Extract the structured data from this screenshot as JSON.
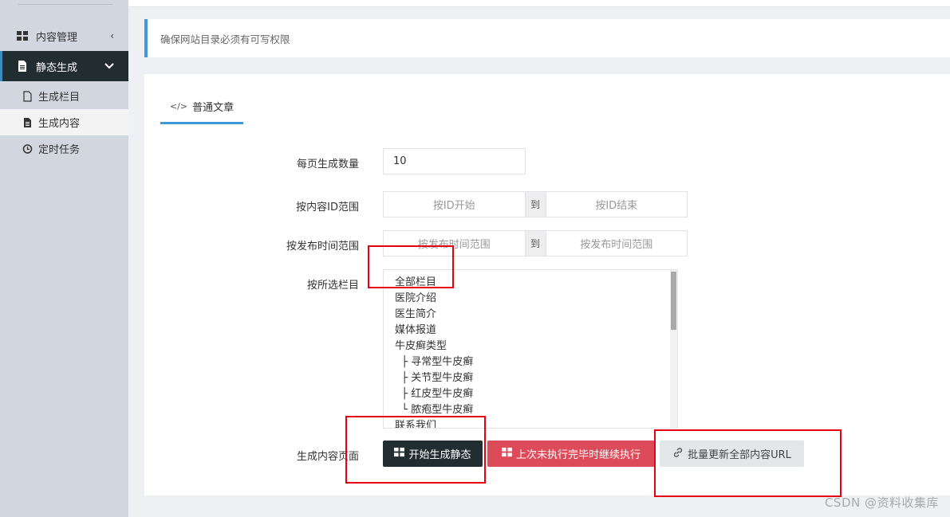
{
  "sidebar": {
    "content_manage": {
      "label": "内容管理",
      "arrow": "‹"
    },
    "static_gen": {
      "label": "静态生成",
      "arrow": "⌄"
    },
    "sub_items": [
      {
        "label": "生成栏目"
      },
      {
        "label": "生成内容"
      },
      {
        "label": "定时任务"
      }
    ]
  },
  "alert": {
    "text": "确保网站目录必须有可写权限"
  },
  "tab": {
    "icon": "code-icon",
    "label": "普通文章"
  },
  "form": {
    "count": {
      "label": "每页生成数量",
      "value": "10"
    },
    "id_range": {
      "label": "按内容ID范围",
      "start_placeholder": "按ID开始",
      "separator": "到",
      "end_placeholder": "按ID结束"
    },
    "time_range": {
      "label": "按发布时间范围",
      "start_placeholder": "按发布时间范围",
      "separator": "到",
      "end_placeholder": "按发布时间范围"
    },
    "category": {
      "label": "按所选栏目",
      "options": [
        "全部栏目",
        "医院介绍",
        "医生简介",
        "媒体报道",
        "牛皮癣类型",
        "  ├ 寻常型牛皮癣",
        "  ├ 关节型牛皮癣",
        "  ├ 红皮型牛皮癣",
        "  └ 脓疱型牛皮癣",
        "联系我们"
      ]
    },
    "actions": {
      "label": "生成内容页面",
      "start": "开始生成静态",
      "continue": "上次未执行完毕时继续执行",
      "update_url": "批量更新全部内容URL"
    }
  },
  "watermark": "CSDN @资料收集库",
  "colors": {
    "sidebar_bg": "#d2d6de",
    "active_bg": "#222d32",
    "accent": "#3c9bd6",
    "danger": "#dd4b5a",
    "highlight": "#e60012"
  }
}
